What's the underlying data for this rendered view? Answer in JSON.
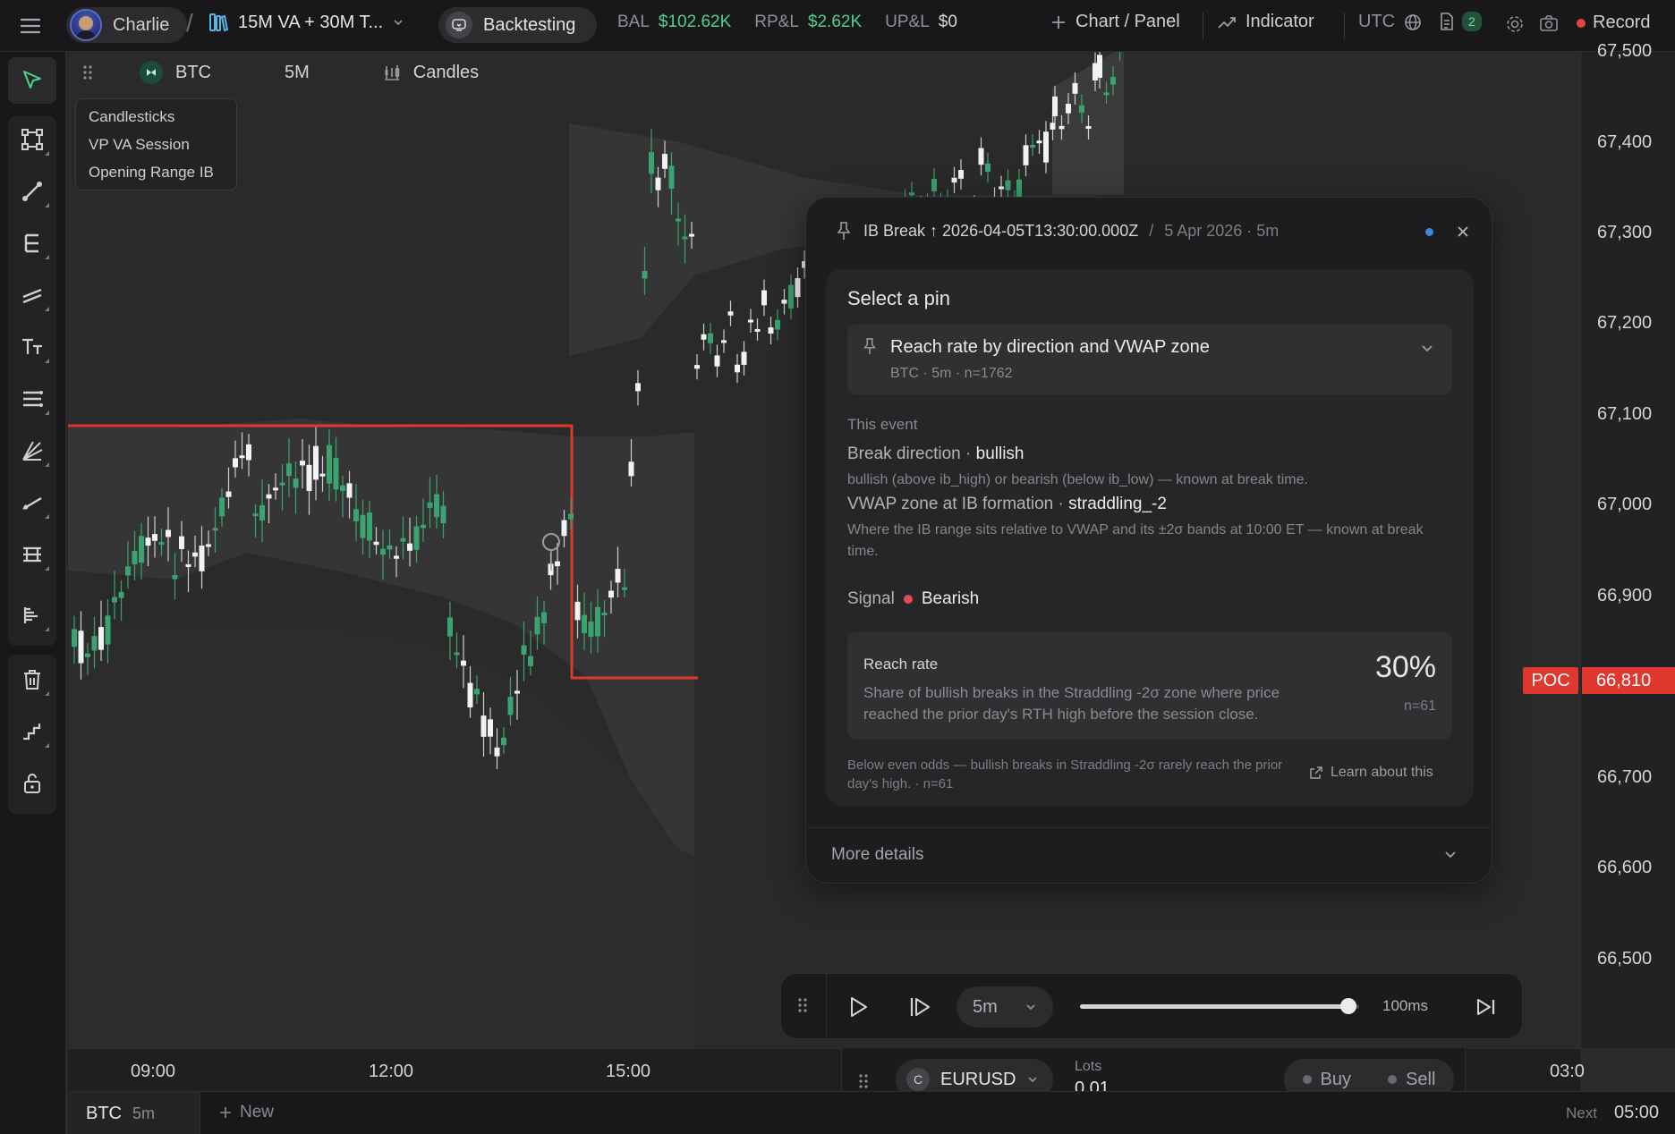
{
  "topbar": {
    "user": "Charlie",
    "layout": "15M VA + 30M T...",
    "mode": "Backtesting",
    "bal_label": "BAL",
    "bal_value": "$102.62K",
    "rpl_label": "RP&L",
    "rpl_value": "$2.62K",
    "upl_label": "UP&L",
    "upl_value": "$0",
    "chart_panel": "Chart / Panel",
    "indicator": "Indicator",
    "timezone": "UTC",
    "doc_badge": "2",
    "record": "Record"
  },
  "chart": {
    "symbol": "BTC",
    "timeframe": "5M",
    "chart_type": "Candles",
    "legend": [
      "Candlesticks",
      "VP VA Session",
      "Opening Range IB"
    ],
    "price_labels": [
      "67,500",
      "67,400",
      "67,300",
      "67,200",
      "67,100",
      "67,000",
      "66,900",
      "66,700",
      "66,600",
      "66,500"
    ],
    "time_labels": [
      "09:00",
      "12:00",
      "15:00",
      "03:0"
    ],
    "poc_label": "POC",
    "poc_price": "66,810",
    "ib_line_color": "#e0372e",
    "up_color": "#3aa36f",
    "down_color": "#f2f2f2"
  },
  "popup": {
    "title": "IB Break ↑ 2026-04-05T13:30:00.000Z",
    "divider": "/",
    "subtitle": "5 Apr 2026 · 5m",
    "select_title": "Select a pin",
    "selector_main": "Reach rate by direction and VWAP zone",
    "selector_sub": "BTC · 5m · n=1762",
    "section_label": "This event",
    "break_dir_label": "Break direction ·",
    "break_dir_value": "bullish",
    "break_dir_desc": "bullish (above ib_high) or bearish (below ib_low) — known at break time.",
    "vwap_label": "VWAP zone at IB formation ·",
    "vwap_value": "straddling_-2",
    "vwap_desc": "Where the IB range sits relative to VWAP and its ±2σ bands at 10:00 ET — known at break time.",
    "signal_label": "Signal",
    "signal_value": "Bearish",
    "reach_title": "Reach rate",
    "reach_desc": "Share of bullish breaks in the Straddling -2σ zone where price reached the prior day's RTH high before the session close.",
    "reach_value": "30%",
    "reach_n": "n=61",
    "footer_desc": "Below even odds — bullish breaks in Straddling -2σ rarely reach the prior day's high. · n=61",
    "learn": "Learn about this",
    "more": "More details"
  },
  "replay": {
    "speed": "5m",
    "interval": "100ms",
    "progress": 0.96
  },
  "order": {
    "symbol_initial": "C",
    "symbol": "EURUSD",
    "lots_label": "Lots",
    "lots_value": "0.01",
    "buy": "Buy",
    "sell": "Sell"
  },
  "bottom": {
    "tab_symbol": "BTC",
    "tab_tf": "5m",
    "new_tab": "New",
    "next_label": "Next",
    "next_value": "05:00"
  }
}
